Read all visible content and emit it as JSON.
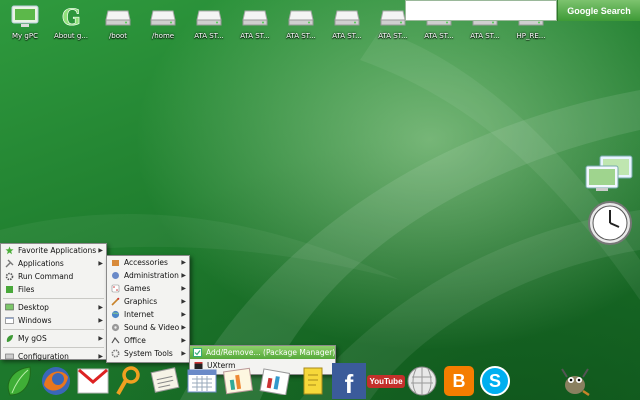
{
  "desktop": {
    "icons": [
      {
        "label": "My gPC",
        "icon": "monitor-icon"
      },
      {
        "label": "About g...",
        "icon": "gos-logo-icon"
      },
      {
        "label": "/boot",
        "icon": "drive-icon"
      },
      {
        "label": "/home",
        "icon": "drive-icon"
      },
      {
        "label": "ATA ST...",
        "icon": "drive-icon"
      },
      {
        "label": "ATA ST...",
        "icon": "drive-icon"
      },
      {
        "label": "ATA ST...",
        "icon": "drive-icon"
      },
      {
        "label": "ATA ST...",
        "icon": "drive-icon"
      },
      {
        "label": "ATA ST...",
        "icon": "drive-icon"
      },
      {
        "label": "ATA ST...",
        "icon": "drive-icon"
      },
      {
        "label": "ATA ST...",
        "icon": "drive-icon"
      },
      {
        "label": "HP_RE...",
        "icon": "drive-icon"
      }
    ]
  },
  "search": {
    "placeholder": "",
    "button_label": "Google Search"
  },
  "main_menu": {
    "items": [
      {
        "label": "Favorite Applications",
        "icon": "star-icon",
        "submenu": true
      },
      {
        "label": "Applications",
        "icon": "applications-icon",
        "submenu": true
      },
      {
        "label": "Run Command",
        "icon": "gear-icon",
        "submenu": false
      },
      {
        "label": "Files",
        "icon": "files-icon",
        "submenu": false
      },
      {
        "label": "Desktop",
        "icon": "desktop-icon",
        "submenu": true
      },
      {
        "label": "Windows",
        "icon": "windows-icon",
        "submenu": true
      },
      {
        "label": "My gOS",
        "icon": "leaf-icon",
        "submenu": true
      },
      {
        "label": "Configuration",
        "icon": "configuration-icon",
        "submenu": true
      }
    ]
  },
  "apps_menu": {
    "items": [
      {
        "label": "Accessories",
        "icon": "accessories-icon"
      },
      {
        "label": "Administration",
        "icon": "administration-icon"
      },
      {
        "label": "Games",
        "icon": "games-icon"
      },
      {
        "label": "Graphics",
        "icon": "graphics-icon"
      },
      {
        "label": "Internet",
        "icon": "internet-icon"
      },
      {
        "label": "Sound & Video",
        "icon": "sound-video-icon"
      },
      {
        "label": "Office",
        "icon": "office-icon"
      },
      {
        "label": "System Tools",
        "icon": "system-tools-icon"
      }
    ]
  },
  "system_tools_menu": {
    "items": [
      {
        "label": "Add/Remove... (Package Manager)",
        "icon": "package-manager-icon",
        "highlighted": true
      },
      {
        "label": "UXterm",
        "icon": "terminal-icon",
        "highlighted": false
      }
    ]
  },
  "dock": {
    "items": [
      {
        "icon": "gos-leaf-icon"
      },
      {
        "icon": "firefox-icon"
      },
      {
        "icon": "gmail-icon"
      },
      {
        "icon": "search-icon"
      },
      {
        "icon": "news-icon"
      },
      {
        "icon": "calendar-icon"
      },
      {
        "icon": "spreadsheet-icon"
      },
      {
        "icon": "notes-icon"
      },
      {
        "icon": "facebook-icon",
        "text": "f"
      },
      {
        "icon": "youtube-icon",
        "text": "YouTube"
      },
      {
        "icon": "wikipedia-icon"
      },
      {
        "icon": "blogger-icon",
        "text": "B"
      },
      {
        "icon": "skype-icon",
        "text": "S"
      },
      {
        "icon": "gimp-icon"
      }
    ]
  },
  "colors": {
    "accent": "#55a83a",
    "desktop_green": "#1f7d2e",
    "menu_bg": "#f3f3f1"
  }
}
